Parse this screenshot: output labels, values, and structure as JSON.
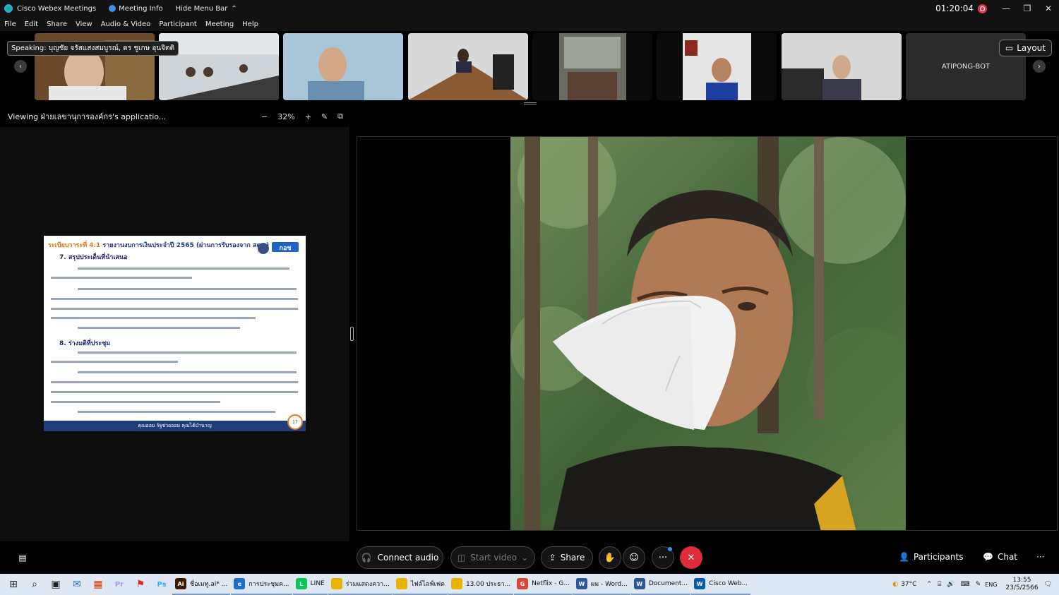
{
  "titlebar": {
    "app_name": "Cisco Webex Meetings",
    "meeting_info": "Meeting Info",
    "hide_menu": "Hide Menu Bar",
    "timer": "01:20:04"
  },
  "menu": [
    "File",
    "Edit",
    "Share",
    "View",
    "Audio & Video",
    "Participant",
    "Meeting",
    "Help"
  ],
  "strip": {
    "speaking": "Speaking: บุญชัย จรัสแสงสมบูรณ์, ดร ชูเกษ อุนจิตติ",
    "layout_label": "Layout",
    "bot_name": "ATIPONG-BOT"
  },
  "viewbar": {
    "viewing_text": "Viewing ฝ่ายเลขานุการองค์กร's applicatio...",
    "zoom": "32%",
    "zoom_minus": "−",
    "zoom_plus": "+"
  },
  "slide": {
    "agenda_num": "ระเบียบวาระที่ 4.1",
    "agenda_title": "รายงานงบการเงินประจำปี 2565 (ผ่านการรับรองจาก สตง.)",
    "section7": "7. สรุปประเด็นที่นำเสนอ",
    "section8": "8. ร่างมติที่ประชุม",
    "footer": "คุณออม รัฐช่วยออม คุณได้บำนาญ",
    "page": "17",
    "logo_text": "กอช"
  },
  "controls": {
    "connect_audio": "Connect audio",
    "start_video": "Start video",
    "share": "Share",
    "participants": "Participants",
    "chat": "Chat",
    "more": "···"
  },
  "taskbar": {
    "apps": [
      {
        "label": "ชื่อเมทู.ai* ...",
        "color": "#3a1a00",
        "glyph": "Ai"
      },
      {
        "label": "การประชุมค...",
        "color": "#1c6fd1",
        "glyph": "e"
      },
      {
        "label": "LINE",
        "color": "#06c755",
        "glyph": "L"
      },
      {
        "label": "ร่วมแสดงควา...",
        "color": "#e8b400",
        "glyph": ""
      },
      {
        "label": "ไฟล์ไลฟ์เฟด",
        "color": "#e8b400",
        "glyph": ""
      },
      {
        "label": "13.00 ประธา...",
        "color": "#e8b400",
        "glyph": ""
      },
      {
        "label": "Netflix - G...",
        "color": "#db4437",
        "glyph": "G"
      },
      {
        "label": "ผม - Word...",
        "color": "#2b579a",
        "glyph": "W"
      },
      {
        "label": "Document...",
        "color": "#2b579a",
        "glyph": "W"
      },
      {
        "label": "Cisco Web...",
        "color": "#0a5cae",
        "glyph": "W"
      }
    ],
    "temperature": "37°C",
    "time": "13:55",
    "date": "23/5/2566",
    "lang": "ENG"
  },
  "colors": {
    "end_call": "#e02b3a",
    "accent": "#1f3d7a"
  }
}
